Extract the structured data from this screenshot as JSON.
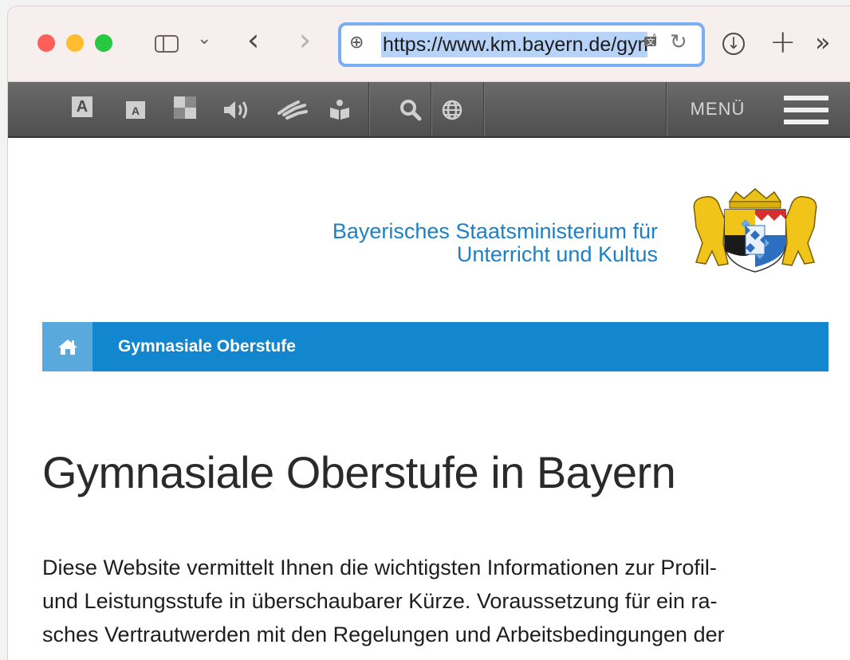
{
  "browser": {
    "url": "https://www.km.bayern.de/gym",
    "icons": [
      "sidebar-icon",
      "chevron-down-icon",
      "back-icon",
      "forward-icon",
      "globe-icon",
      "translate-icon",
      "reload-icon",
      "download-icon",
      "new-tab-icon",
      "more-icon"
    ]
  },
  "sitebar": {
    "font_large_label": "A",
    "font_small_label": "A",
    "menu_label": "MENÜ",
    "icons": [
      "font-larger-icon",
      "font-smaller-icon",
      "contrast-icon",
      "speaker-icon",
      "sign-language-icon",
      "easy-language-icon",
      "search-icon",
      "language-globe-icon",
      "hamburger-menu-icon"
    ]
  },
  "header": {
    "ministry_line1": "Bayerisches Staatsministerium für",
    "ministry_line2": "Unterricht und Kultus"
  },
  "breadcrumb": {
    "current": "Gymnasiale Oberstufe"
  },
  "main": {
    "title": "Gymnasiale Oberstufe in Bayern",
    "intro_lines": [
      "Diese Website vermittelt Ihnen die wichtigsten Informationen zur Profil-",
      "und Leistungsstufe in überschaubarer Kürze. Voraussetzung für ein ra-",
      "sches Vertrautwerden mit den Regelungen und Arbeitsbedingungen der"
    ]
  },
  "colors": {
    "accent_blue": "#1286cf",
    "home_blue": "#5aa9dc",
    "ministry_text": "#1d7fc6"
  }
}
